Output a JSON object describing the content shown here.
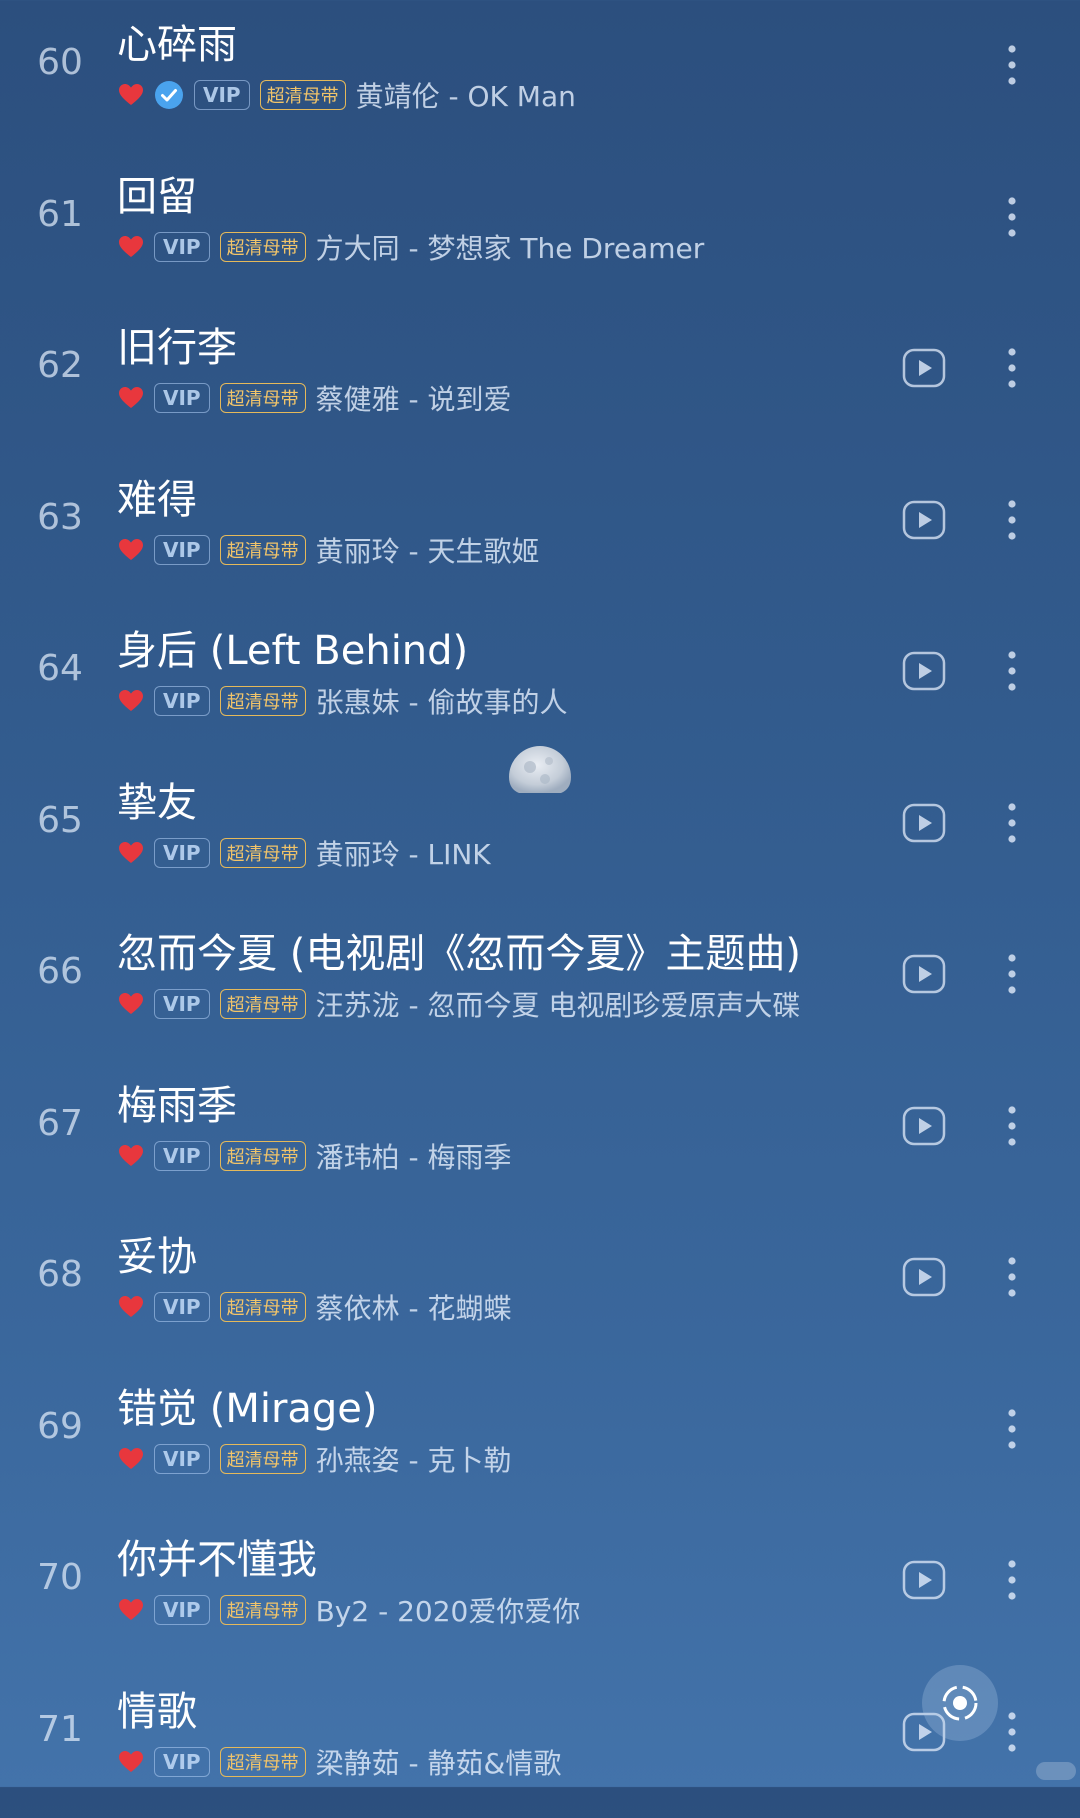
{
  "songs": [
    {
      "index": "60",
      "title": "心碎雨",
      "liked": true,
      "verified": true,
      "vip": "VIP",
      "quality": "超清母带",
      "artist_album": "黄靖伦 - OK Man",
      "has_mv": false
    },
    {
      "index": "61",
      "title": "回留",
      "liked": true,
      "verified": false,
      "vip": "VIP",
      "quality": "超清母带",
      "artist_album": "方大同 - 梦想家 The Dreamer",
      "has_mv": false
    },
    {
      "index": "62",
      "title": "旧行李",
      "liked": true,
      "verified": false,
      "vip": "VIP",
      "quality": "超清母带",
      "artist_album": "蔡健雅 - 说到爱",
      "has_mv": true
    },
    {
      "index": "63",
      "title": "难得",
      "liked": true,
      "verified": false,
      "vip": "VIP",
      "quality": "超清母带",
      "artist_album": "黄丽玲 - 天生歌姬",
      "has_mv": true
    },
    {
      "index": "64",
      "title": "身后 (Left Behind)",
      "liked": true,
      "verified": false,
      "vip": "VIP",
      "quality": "超清母带",
      "artist_album": "张惠妹 - 偷故事的人",
      "has_mv": true
    },
    {
      "index": "65",
      "title": "挚友",
      "liked": true,
      "verified": false,
      "vip": "VIP",
      "quality": "超清母带",
      "artist_album": "黄丽玲 - LINK",
      "has_mv": true
    },
    {
      "index": "66",
      "title": "忽而今夏 (电视剧《忽而今夏》主题曲)",
      "liked": true,
      "verified": false,
      "vip": "VIP",
      "quality": "超清母带",
      "artist_album": "汪苏泷 - 忽而今夏 电视剧珍爱原声大碟",
      "has_mv": true
    },
    {
      "index": "67",
      "title": "梅雨季",
      "liked": true,
      "verified": false,
      "vip": "VIP",
      "quality": "超清母带",
      "artist_album": "潘玮柏 - 梅雨季",
      "has_mv": true
    },
    {
      "index": "68",
      "title": "妥协",
      "liked": true,
      "verified": false,
      "vip": "VIP",
      "quality": "超清母带",
      "artist_album": "蔡依林 - 花蝴蝶",
      "has_mv": true
    },
    {
      "index": "69",
      "title": "错觉 (Mirage)",
      "liked": true,
      "verified": false,
      "vip": "VIP",
      "quality": "超清母带",
      "artist_album": "孙燕姿 - 克卜勒",
      "has_mv": false
    },
    {
      "index": "70",
      "title": "你并不懂我",
      "liked": true,
      "verified": false,
      "vip": "VIP",
      "quality": "超清母带",
      "artist_album": "By2 - 2020爱你爱你",
      "has_mv": true
    },
    {
      "index": "71",
      "title": "情歌",
      "liked": true,
      "verified": false,
      "vip": "VIP",
      "quality": "超清母带",
      "artist_album": "梁静茹 - 静茹&情歌",
      "has_mv": true
    }
  ],
  "colors": {
    "heart": "#e8373d",
    "verified": "#4aa3ee",
    "quality_badge": "#f1c46a",
    "background_top": "#2c4f7e",
    "background_bottom": "#4373aa"
  },
  "icons": {
    "like": "heart-icon",
    "verified": "verified-check-icon",
    "mv": "play-video-icon",
    "more": "more-vertical-icon",
    "floating": "recognize-icon"
  }
}
